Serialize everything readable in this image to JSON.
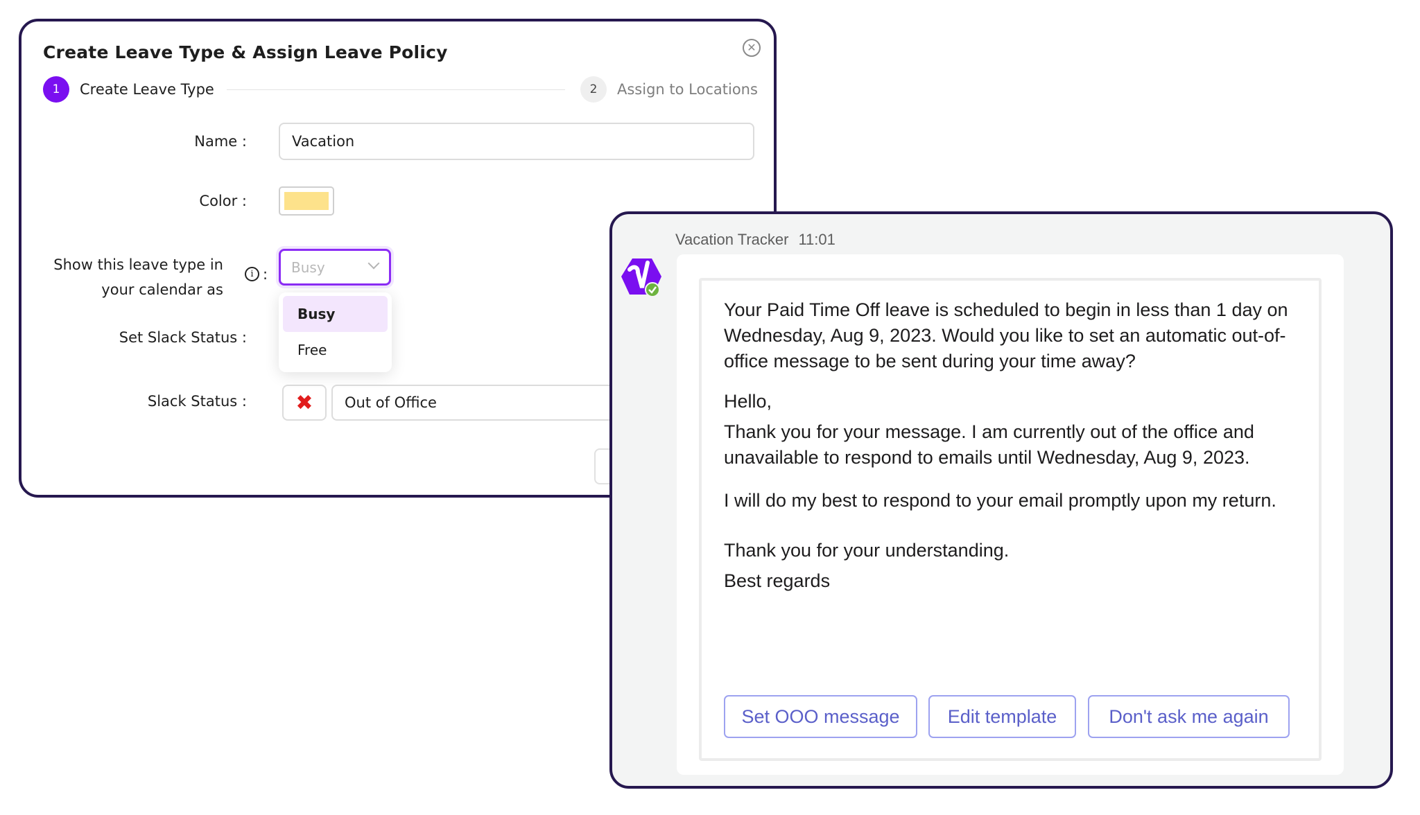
{
  "modal": {
    "title": "Create Leave Type & Assign Leave Policy",
    "close_icon": "close-circle-icon",
    "steps": [
      {
        "number": "1",
        "label": "Create Leave Type",
        "state": "active"
      },
      {
        "number": "2",
        "label": "Assign to Locations",
        "state": "pending"
      }
    ],
    "fields": {
      "name_label": "Name",
      "name_value": "Vacation",
      "color_label": "Color",
      "color_value": "#fde28b",
      "calendar_label_line1": "Show this leave type in",
      "calendar_label_line2": "your calendar as",
      "calendar_selected": "Busy",
      "calendar_options": [
        "Busy",
        "Free"
      ],
      "set_slack_status_label": "Set Slack Status",
      "slack_status_label": "Slack Status",
      "slack_status_emoji": "✖",
      "slack_status_value": "Out of Office"
    },
    "colon": ":"
  },
  "slack": {
    "sender": "Vacation Tracker",
    "time": "11:01",
    "avatar_icon": "vacation-tracker-logo",
    "online_status": "online",
    "paragraphs": [
      "Your Paid Time Off leave is scheduled to begin in less than 1 day on Wednesday, Aug 9, 2023. Would you like to set an automatic out-of-office message to be sent during your time away?",
      "Hello,",
      "Thank you for your message. I am currently out of the office and unavailable to respond to emails until Wednesday, Aug 9, 2023.",
      "I will do my best to respond to your email promptly upon my return.",
      "Thank you for your understanding.",
      "Best regards"
    ],
    "buttons": [
      "Set OOO message",
      "Edit template",
      "Don't ask me again"
    ]
  },
  "colors": {
    "frame_border": "#26184f",
    "primary_purple": "#7a0ff0",
    "slack_button_text": "#5a5fc9",
    "slack_button_border": "#9da2f0"
  }
}
